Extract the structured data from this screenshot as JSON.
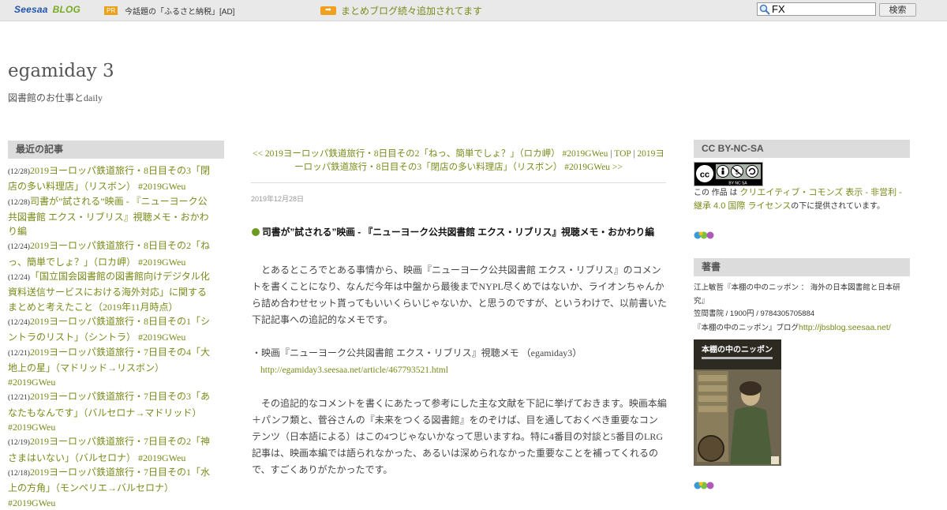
{
  "topbar": {
    "logo_main": "Seesaa",
    "logo_blog": "BLOG",
    "pr_badge": "PR",
    "pr_text": "今話題の「ふるさと納税」[AD]",
    "notice_link": "まとめブログ続々追加されてます",
    "search_value": "FX",
    "search_button": "検索"
  },
  "site": {
    "title": "egamiday 3",
    "description": "図書館のお仕事とdaily"
  },
  "left_sidebar": {
    "heading": "最近の記事",
    "items": [
      {
        "date": "(12/28)",
        "title": "2019ヨーロッパ鉄道旅行・8日目その3「閉店の多い料理店」（リスボン） #2019GWeu"
      },
      {
        "date": "(12/28)",
        "title": "司書が”試される”映画 - 『ニューヨーク公共図書館 エクス・リブリス』視聴メモ・おかわり編"
      },
      {
        "date": "(12/24)",
        "title": "2019ヨーロッパ鉄道旅行・8日目その2「ねっ、簡単でしょ？」（ロカ岬） #2019GWeu"
      },
      {
        "date": "(12/24)",
        "title": "「国立国会図書館の図書館向けデジタル化資料送信サービスにおける海外対応」に関するまとめと考えたこと（2019年11月時点）"
      },
      {
        "date": "(12/24)",
        "title": "2019ヨーロッパ鉄道旅行・8日目その1「シントラのリスト」（シントラ） #2019GWeu"
      },
      {
        "date": "(12/21)",
        "title": "2019ヨーロッパ鉄道旅行・7日目その4「大地上の星」（マドリッド→リスボン） #2019GWeu"
      },
      {
        "date": "(12/21)",
        "title": "2019ヨーロッパ鉄道旅行・7日目その3「あなたもなんです」（バルセロナ→マドリッド） #2019GWeu"
      },
      {
        "date": "(12/19)",
        "title": "2019ヨーロッパ鉄道旅行・7日目その2「神さまはいない」（バルセロナ） #2019GWeu"
      },
      {
        "date": "(12/18)",
        "title": "2019ヨーロッパ鉄道旅行・7日目その1「水上の方角」（モンペリエ→バルセロナ） #2019GWeu"
      }
    ]
  },
  "post": {
    "nav_prev": "<< 2019ヨーロッパ鉄道旅行・8日目その2「ねっ、簡単でしょ？」（ロカ岬） #2019GWeu",
    "nav_sep1": "|",
    "nav_top": "TOP",
    "nav_sep2": "|",
    "nav_next": "2019ヨーロッパ鉄道旅行・8日目その3「閉店の多い料理店」（リスボン） #2019GWeu >>",
    "date": "2019年12月28日",
    "title": "司書が”試される”映画 - 『ニューヨーク公共図書館 エクス・リブリス』視聴メモ・おかわり編",
    "para1": "　とあるところでとある事情から、映画『ニューヨーク公共図書館 エクス・リブリス』のコメントを書くことになり、なんだ今年は中盤から最後までNYPL尽くめではないか、ライオンちゃんから詰め合わせセット貰ってもいいくらいじゃないか、と思うのですが、というわけで、以前書いた下記記事への追記的なメモです。",
    "para2": "・映画『ニューヨーク公共図書館 エクス・リブリス』視聴メモ （egamiday3）",
    "link": "http://egamiday3.seesaa.net/article/467793521.html",
    "para3": "　その追記的なコメントを書くにあたって参考にした主な文献を下記に挙げておきます。映画本編＋パンフ類と、菅谷さんの『未来をつくる図書館』をのぞけば、目を通しておくべき重要なコンテンツ（日本語による）はこの4つじゃないかなって思いますね。特に4番目の対談と5番目のLRG記事は、映画本編では語られなかった、あるいは深められなかった重要なことを補ってくれるので、すごくありがたかったです。"
  },
  "right_sidebar": {
    "license_heading": "CC BY-NC-SA",
    "license_prefix": "この 作品 は ",
    "license_link": "クリエイティブ・コモンズ 表示 - 非営利 - 継承 4.0 国際 ライセンス",
    "license_suffix": "の下に提供されています。",
    "books_heading": "著書",
    "book_title": "江上敏哲『本棚の中のニッポン ： 海外の日本図書館と日本研究』",
    "book_publisher": "笠間書院 / 1900円 / 9784305705884",
    "book_blog_prefix": "『本棚の中のニッポン』ブログ",
    "book_blog_link": "http://jbsblog.seesaa.net/",
    "book_cover_title": "本棚の中のニッポン"
  },
  "colors": {
    "link": "#7a8a1a",
    "heading_bg": "#dcdcdc",
    "topbar_bg": "#e9e9e9",
    "bullet": "#6b9a1f"
  }
}
